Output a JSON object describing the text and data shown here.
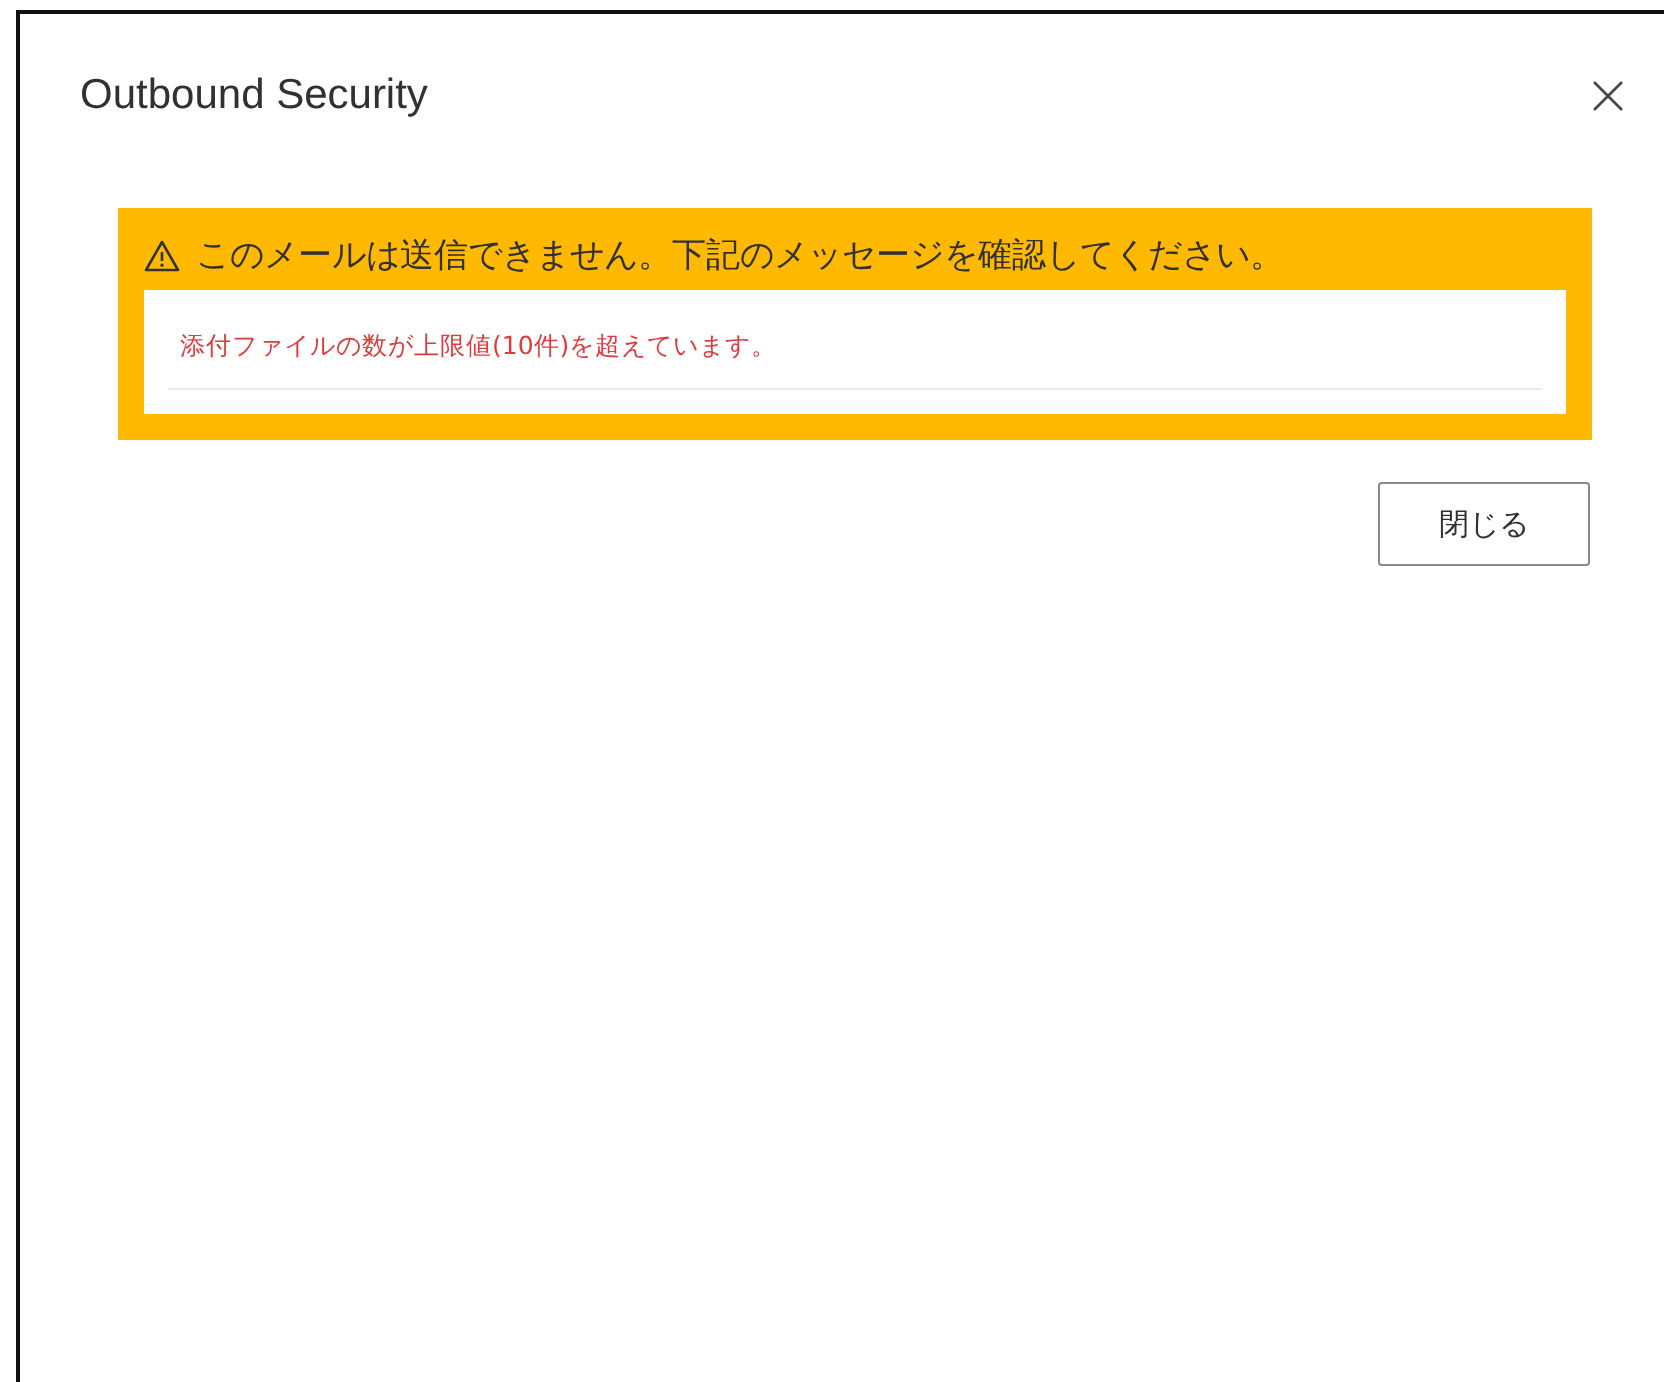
{
  "dialog": {
    "title": "Outbound Security"
  },
  "warning": {
    "heading": "このメールは送信できません。下記のメッセージを確認してください。",
    "messages": [
      "添付ファイルの数が上限値(10件)を超えています。"
    ]
  },
  "buttons": [
    "閉じる"
  ]
}
